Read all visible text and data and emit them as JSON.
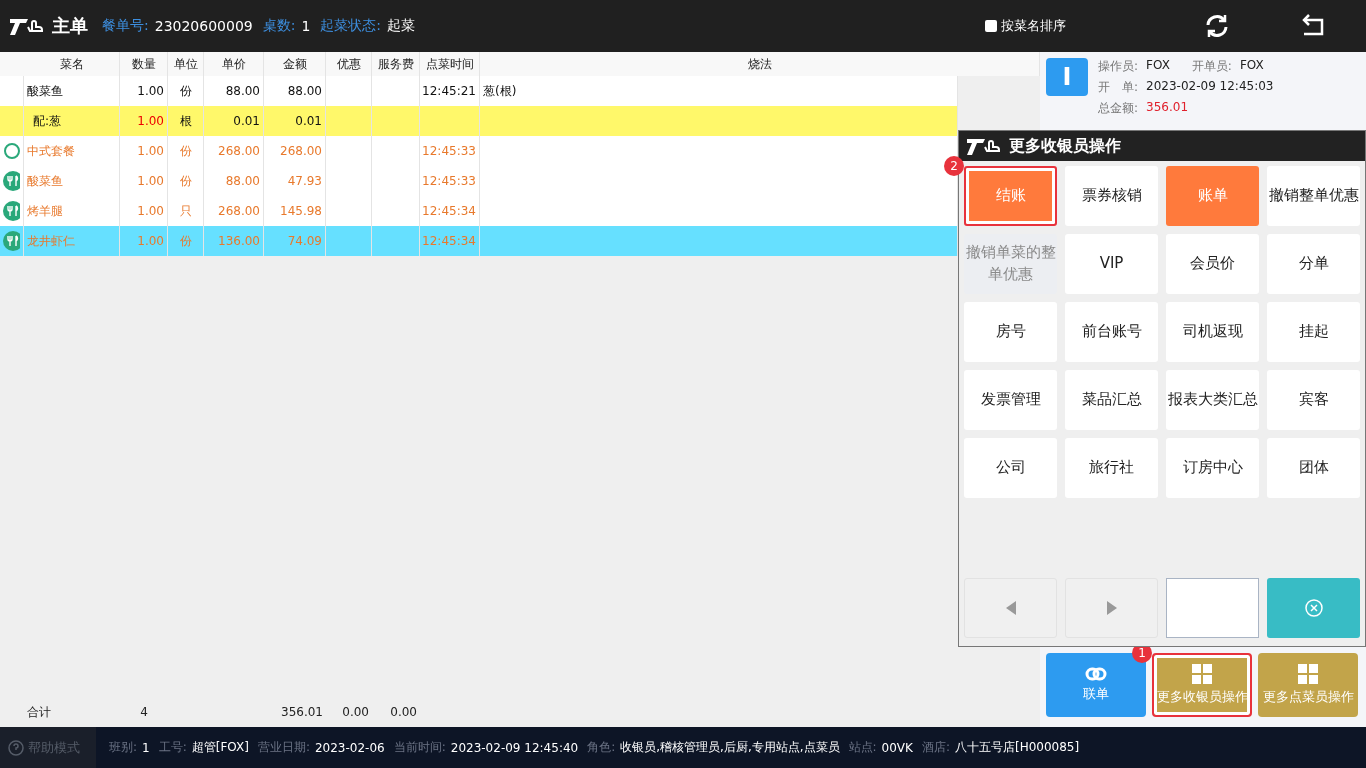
{
  "header": {
    "title": "主单",
    "fields": [
      {
        "label": "餐单号:",
        "value": "23020600009"
      },
      {
        "label": "桌数:",
        "value": "1"
      },
      {
        "label": "起菜状态:",
        "value": "起菜"
      }
    ],
    "sort_checkbox": {
      "label": "按菜名排序",
      "checked": false
    }
  },
  "table": {
    "columns": [
      "菜名",
      "数量",
      "单位",
      "单价",
      "金额",
      "优惠",
      "服务费",
      "点菜时间",
      "烧法"
    ],
    "rows": [
      {
        "kind": "normal",
        "selected": false,
        "cells": [
          "酸菜鱼",
          "1.00",
          "份",
          "88.00",
          "88.00",
          "",
          "",
          "12:45:21",
          "葱(根)"
        ]
      },
      {
        "kind": "addon",
        "selected": false,
        "cells": [
          "配:葱",
          "1.00",
          "根",
          "0.01",
          "0.01",
          "",
          "",
          "",
          ""
        ]
      },
      {
        "kind": "set",
        "selected": false,
        "cells": [
          "中式套餐",
          "1.00",
          "份",
          "268.00",
          "268.00",
          "",
          "",
          "12:45:33",
          ""
        ]
      },
      {
        "kind": "dish",
        "selected": false,
        "cells": [
          "酸菜鱼",
          "1.00",
          "份",
          "88.00",
          "47.93",
          "",
          "",
          "12:45:33",
          ""
        ]
      },
      {
        "kind": "dish",
        "selected": false,
        "cells": [
          "烤羊腿",
          "1.00",
          "只",
          "268.00",
          "145.98",
          "",
          "",
          "12:45:34",
          ""
        ]
      },
      {
        "kind": "dish",
        "selected": true,
        "cells": [
          "龙井虾仁",
          "1.00",
          "份",
          "136.00",
          "74.09",
          "",
          "",
          "12:45:34",
          ""
        ]
      }
    ],
    "totals": {
      "label": "合计",
      "quantity": "4",
      "amount": "356.01",
      "discount": "0.00",
      "service": "0.00"
    }
  },
  "info": {
    "badge": "I",
    "lines": [
      [
        {
          "label": "操作员:",
          "value": "FOX",
          "kind": "plain"
        },
        {
          "label": "开单员:",
          "value": "FOX",
          "kind": "plain"
        }
      ],
      [
        {
          "label": "开　单:",
          "value": "2023-02-09 12:45:03",
          "kind": "plain"
        }
      ],
      [
        {
          "label": "总金额:",
          "value": "356.01",
          "kind": "alert"
        }
      ]
    ]
  },
  "popup": {
    "title": "更多收银员操作",
    "buttons": [
      {
        "label": "结账",
        "kind": "primary",
        "highlighted": true,
        "step": "2"
      },
      {
        "label": "票券核销",
        "kind": "default",
        "highlighted": false
      },
      {
        "label": "账单",
        "kind": "primary",
        "highlighted": false
      },
      {
        "label": "撤销整单优惠",
        "kind": "default",
        "highlighted": false
      },
      {
        "label": "撤销单菜的整单优惠",
        "kind": "disabled",
        "highlighted": false
      },
      {
        "label": "VIP",
        "kind": "default",
        "highlighted": false
      },
      {
        "label": "会员价",
        "kind": "default",
        "highlighted": false
      },
      {
        "label": "分单",
        "kind": "default",
        "highlighted": false
      },
      {
        "label": "房号",
        "kind": "default",
        "highlighted": false
      },
      {
        "label": "前台账号",
        "kind": "default",
        "highlighted": false
      },
      {
        "label": "司机返现",
        "kind": "default",
        "highlighted": false
      },
      {
        "label": "挂起",
        "kind": "default",
        "highlighted": false
      },
      {
        "label": "发票管理",
        "kind": "default",
        "highlighted": false
      },
      {
        "label": "菜品汇总",
        "kind": "default",
        "highlighted": false
      },
      {
        "label": "报表大类汇总",
        "kind": "default",
        "highlighted": false
      },
      {
        "label": "宾客",
        "kind": "default",
        "highlighted": false
      },
      {
        "label": "公司",
        "kind": "default",
        "highlighted": false
      },
      {
        "label": "旅行社",
        "kind": "default",
        "highlighted": false
      },
      {
        "label": "订房中心",
        "kind": "default",
        "highlighted": false
      },
      {
        "label": "团体",
        "kind": "default",
        "highlighted": false
      }
    ]
  },
  "actions": [
    {
      "label": "联单",
      "kind": "link",
      "highlighted": false
    },
    {
      "label": "更多收银员操作",
      "kind": "more",
      "highlighted": true,
      "step": "1"
    },
    {
      "label": "更多点菜员操作",
      "kind": "more",
      "highlighted": false
    }
  ],
  "status_bar": {
    "help": "帮助模式",
    "fields": [
      {
        "label": "班别:",
        "value": "1"
      },
      {
        "label": "工号:",
        "value": "超管[FOX]"
      },
      {
        "label": "营业日期:",
        "value": "2023-02-06"
      },
      {
        "label": "当前时间:",
        "value": "2023-02-09 12:45:40"
      },
      {
        "label": "角色:",
        "value": "收银员,稽核管理员,后厨,专用站点,点菜员"
      },
      {
        "label": "站点:",
        "value": "00VK"
      },
      {
        "label": "酒店:",
        "value": "八十五号店[H000085]"
      }
    ]
  }
}
